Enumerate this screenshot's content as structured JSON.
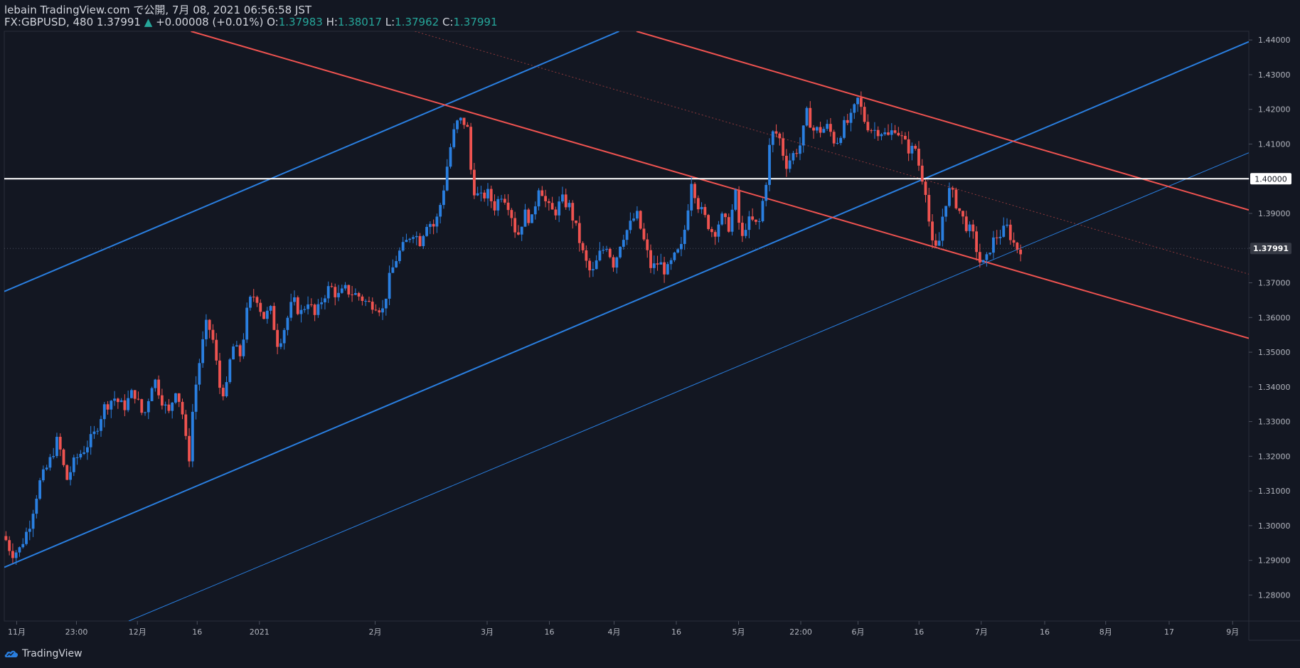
{
  "header": {
    "published_line": "lebain TradingView.com で公開, 7月 08, 2021 06:56:58 JST",
    "symbol": "FX:GBPUSD, 480",
    "last": "1.37991",
    "change": "+0.00008 (+0.01%)",
    "o_label": "O:",
    "o_value": "1.37983",
    "h_label": "H:",
    "h_value": "1.38017",
    "l_label": "L:",
    "l_value": "1.37962",
    "c_label": "C:",
    "c_value": "1.37991"
  },
  "brand": {
    "name": "TradingView",
    "icon": "tradingview-cloud-icon"
  },
  "colors": {
    "background": "#131722",
    "bull": "#2a7fe0",
    "bear": "#ef5350",
    "channel_blue": "#2a7fe0",
    "channel_red": "#ef5350",
    "level_line": "#ffffff",
    "axis_text": "#b2b5be",
    "price_badge_bg": "#363a45"
  },
  "chart_data": {
    "type": "candlestick",
    "symbol": "FX:GBPUSD",
    "ylim": [
      1.2725,
      1.4425
    ],
    "y_ticks": [
      "1.28000",
      "1.29000",
      "1.30000",
      "1.31000",
      "1.32000",
      "1.33000",
      "1.34000",
      "1.35000",
      "1.36000",
      "1.37000",
      "1.38000",
      "1.39000",
      "1.40000",
      "1.41000",
      "1.42000",
      "1.43000",
      "1.44000"
    ],
    "x_ticks": [
      {
        "label": "11月",
        "t": 0.01
      },
      {
        "label": "23:00",
        "t": 0.058
      },
      {
        "label": "12月",
        "t": 0.107
      },
      {
        "label": "16",
        "t": 0.155
      },
      {
        "label": "2021",
        "t": 0.205
      },
      {
        "label": "2月",
        "t": 0.298
      },
      {
        "label": "3月",
        "t": 0.388
      },
      {
        "label": "16",
        "t": 0.438
      },
      {
        "label": "4月",
        "t": 0.49
      },
      {
        "label": "16",
        "t": 0.54
      },
      {
        "label": "5月",
        "t": 0.59
      },
      {
        "label": "22:00",
        "t": 0.64
      },
      {
        "label": "6月",
        "t": 0.686
      },
      {
        "label": "16",
        "t": 0.735
      },
      {
        "label": "7月",
        "t": 0.785
      },
      {
        "label": "16",
        "t": 0.836
      },
      {
        "label": "8月",
        "t": 0.885
      },
      {
        "label": "17",
        "t": 0.936
      },
      {
        "label": "9月",
        "t": 0.987
      }
    ],
    "price_path": [
      [
        0.0,
        1.297
      ],
      [
        0.006,
        1.292
      ],
      [
        0.012,
        1.293
      ],
      [
        0.02,
        1.3
      ],
      [
        0.028,
        1.312
      ],
      [
        0.036,
        1.318
      ],
      [
        0.043,
        1.325
      ],
      [
        0.05,
        1.313
      ],
      [
        0.057,
        1.319
      ],
      [
        0.064,
        1.322
      ],
      [
        0.072,
        1.326
      ],
      [
        0.08,
        1.334
      ],
      [
        0.088,
        1.337
      ],
      [
        0.096,
        1.334
      ],
      [
        0.104,
        1.339
      ],
      [
        0.112,
        1.331
      ],
      [
        0.12,
        1.343
      ],
      [
        0.126,
        1.337
      ],
      [
        0.132,
        1.332
      ],
      [
        0.138,
        1.34
      ],
      [
        0.144,
        1.331
      ],
      [
        0.148,
        1.317
      ],
      [
        0.152,
        1.336
      ],
      [
        0.158,
        1.35
      ],
      [
        0.163,
        1.359
      ],
      [
        0.168,
        1.353
      ],
      [
        0.173,
        1.34
      ],
      [
        0.178,
        1.338
      ],
      [
        0.183,
        1.352
      ],
      [
        0.19,
        1.349
      ],
      [
        0.196,
        1.364
      ],
      [
        0.202,
        1.367
      ],
      [
        0.208,
        1.36
      ],
      [
        0.214,
        1.362
      ],
      [
        0.22,
        1.352
      ],
      [
        0.226,
        1.358
      ],
      [
        0.232,
        1.365
      ],
      [
        0.238,
        1.361
      ],
      [
        0.244,
        1.365
      ],
      [
        0.25,
        1.36
      ],
      [
        0.256,
        1.366
      ],
      [
        0.262,
        1.369
      ],
      [
        0.268,
        1.366
      ],
      [
        0.274,
        1.368
      ],
      [
        0.28,
        1.367
      ],
      [
        0.286,
        1.366
      ],
      [
        0.292,
        1.364
      ],
      [
        0.298,
        1.364
      ],
      [
        0.304,
        1.362
      ],
      [
        0.31,
        1.372
      ],
      [
        0.316,
        1.378
      ],
      [
        0.322,
        1.381
      ],
      [
        0.328,
        1.385
      ],
      [
        0.334,
        1.382
      ],
      [
        0.34,
        1.388
      ],
      [
        0.346,
        1.386
      ],
      [
        0.352,
        1.395
      ],
      [
        0.356,
        1.404
      ],
      [
        0.36,
        1.412
      ],
      [
        0.364,
        1.416
      ],
      [
        0.368,
        1.417
      ],
      [
        0.372,
        1.415
      ],
      [
        0.376,
        1.398
      ],
      [
        0.382,
        1.394
      ],
      [
        0.388,
        1.396
      ],
      [
        0.394,
        1.392
      ],
      [
        0.4,
        1.396
      ],
      [
        0.406,
        1.392
      ],
      [
        0.412,
        1.383
      ],
      [
        0.418,
        1.39
      ],
      [
        0.424,
        1.388
      ],
      [
        0.43,
        1.399
      ],
      [
        0.436,
        1.392
      ],
      [
        0.442,
        1.39
      ],
      [
        0.448,
        1.394
      ],
      [
        0.454,
        1.392
      ],
      [
        0.46,
        1.385
      ],
      [
        0.466,
        1.377
      ],
      [
        0.472,
        1.372
      ],
      [
        0.478,
        1.378
      ],
      [
        0.484,
        1.381
      ],
      [
        0.49,
        1.375
      ],
      [
        0.496,
        1.383
      ],
      [
        0.502,
        1.386
      ],
      [
        0.508,
        1.39
      ],
      [
        0.514,
        1.382
      ],
      [
        0.52,
        1.374
      ],
      [
        0.526,
        1.376
      ],
      [
        0.532,
        1.373
      ],
      [
        0.538,
        1.377
      ],
      [
        0.544,
        1.38
      ],
      [
        0.548,
        1.388
      ],
      [
        0.552,
        1.4
      ],
      [
        0.558,
        1.392
      ],
      [
        0.564,
        1.388
      ],
      [
        0.57,
        1.384
      ],
      [
        0.576,
        1.389
      ],
      [
        0.582,
        1.386
      ],
      [
        0.588,
        1.396
      ],
      [
        0.592,
        1.381
      ],
      [
        0.596,
        1.387
      ],
      [
        0.6,
        1.388
      ],
      [
        0.606,
        1.386
      ],
      [
        0.612,
        1.399
      ],
      [
        0.616,
        1.413
      ],
      [
        0.622,
        1.413
      ],
      [
        0.628,
        1.404
      ],
      [
        0.634,
        1.407
      ],
      [
        0.64,
        1.41
      ],
      [
        0.645,
        1.419
      ],
      [
        0.65,
        1.414
      ],
      [
        0.656,
        1.414
      ],
      [
        0.662,
        1.415
      ],
      [
        0.668,
        1.41
      ],
      [
        0.674,
        1.415
      ],
      [
        0.68,
        1.417
      ],
      [
        0.686,
        1.423
      ],
      [
        0.692,
        1.416
      ],
      [
        0.698,
        1.414
      ],
      [
        0.704,
        1.414
      ],
      [
        0.71,
        1.412
      ],
      [
        0.716,
        1.415
      ],
      [
        0.722,
        1.411
      ],
      [
        0.728,
        1.408
      ],
      [
        0.732,
        1.409
      ],
      [
        0.736,
        1.402
      ],
      [
        0.74,
        1.398
      ],
      [
        0.745,
        1.381
      ],
      [
        0.75,
        1.379
      ],
      [
        0.755,
        1.392
      ],
      [
        0.76,
        1.397
      ],
      [
        0.766,
        1.392
      ],
      [
        0.772,
        1.387
      ],
      [
        0.778,
        1.384
      ],
      [
        0.784,
        1.376
      ],
      [
        0.788,
        1.375
      ],
      [
        0.792,
        1.38
      ],
      [
        0.796,
        1.383
      ],
      [
        0.8,
        1.384
      ],
      [
        0.806,
        1.386
      ],
      [
        0.81,
        1.382
      ],
      [
        0.814,
        1.38
      ],
      [
        0.818,
        1.3799
      ]
    ],
    "last_price": "1.37991",
    "level_price": "1.40000",
    "lines": [
      {
        "name": "blue-channel-upper",
        "color": "blue",
        "width": 2,
        "p1": [
          0.0,
          1.3675
        ],
        "p2": [
          0.494,
          1.4425
        ]
      },
      {
        "name": "blue-channel-lower",
        "color": "blue",
        "width": 2,
        "p1": [
          0.0,
          1.288
        ],
        "p2": [
          1.0,
          1.4395
        ]
      },
      {
        "name": "blue-thin-trend",
        "color": "blue",
        "width": 1,
        "p1": [
          0.1,
          1.2725
        ],
        "p2": [
          1.0,
          1.4075
        ]
      },
      {
        "name": "red-channel-upper",
        "color": "red",
        "width": 2,
        "p1": [
          0.508,
          1.4425
        ],
        "p2": [
          1.0,
          1.391
        ]
      },
      {
        "name": "red-channel-lower",
        "color": "red",
        "width": 2,
        "p1": [
          0.15,
          1.4425
        ],
        "p2": [
          1.0,
          1.354
        ]
      },
      {
        "name": "red-dotted-median",
        "color": "red",
        "width": 1,
        "dashed": true,
        "p1": [
          0.33,
          1.4425
        ],
        "p2": [
          1.0,
          1.3725
        ]
      }
    ],
    "grid": false
  }
}
